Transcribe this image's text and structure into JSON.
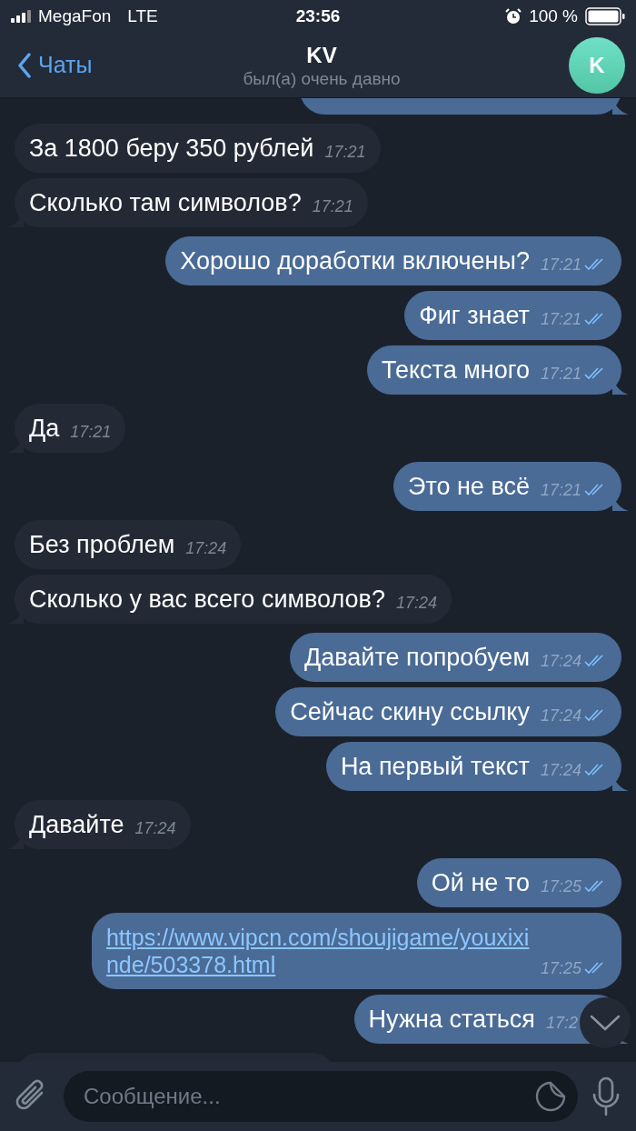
{
  "status_bar": {
    "carrier": "MegaFon",
    "network": "LTE",
    "time": "23:56",
    "battery": "100 %"
  },
  "header": {
    "back": "Чаты",
    "title": "KV",
    "subtitle": "был(а) очень давно",
    "avatar": "K"
  },
  "messages": [
    {
      "kind": "outgoing"
    },
    {
      "kind": "incoming",
      "text": "За 1800 беру 350 рублей",
      "time": "17:21"
    },
    {
      "kind": "incoming",
      "text": "Сколько там символов?",
      "time": "17:21"
    },
    {
      "kind": "outgoing",
      "text": "Хорошо доработки включены?",
      "time": "17:21",
      "read": true
    },
    {
      "kind": "outgoing",
      "text": "Фиг знает",
      "time": "17:21",
      "read": true
    },
    {
      "kind": "outgoing",
      "text": "Текста много",
      "time": "17:21",
      "read": true
    },
    {
      "kind": "incoming",
      "text": "Да",
      "time": "17:21"
    },
    {
      "kind": "outgoing",
      "text": "Это не всё",
      "time": "17:21",
      "read": true
    },
    {
      "kind": "incoming",
      "text": "Без проблем",
      "time": "17:24"
    },
    {
      "kind": "incoming",
      "text": "Сколько у вас всего символов?",
      "time": "17:24"
    },
    {
      "kind": "outgoing",
      "text": "Давайте попробуем",
      "time": "17:24",
      "read": true
    },
    {
      "kind": "outgoing",
      "text": "Сейчас скину ссылку",
      "time": "17:24",
      "read": true
    },
    {
      "kind": "outgoing",
      "text": "На первый текст",
      "time": "17:24",
      "read": true
    },
    {
      "kind": "incoming",
      "text": "Давайте",
      "time": "17:24"
    },
    {
      "kind": "outgoing",
      "text": "Ой не то",
      "time": "17:25",
      "read": true
    },
    {
      "kind": "outgoing",
      "url": "https://www.vipcn.com/shoujigame/youxixinde/503378.html",
      "time": "17:25",
      "read": true
    },
    {
      "kind": "outgoing",
      "text": "Нужна статься",
      "time": "17:2"
    },
    {
      "kind": "incoming"
    }
  ],
  "composer": {
    "placeholder": "Сообщение..."
  }
}
